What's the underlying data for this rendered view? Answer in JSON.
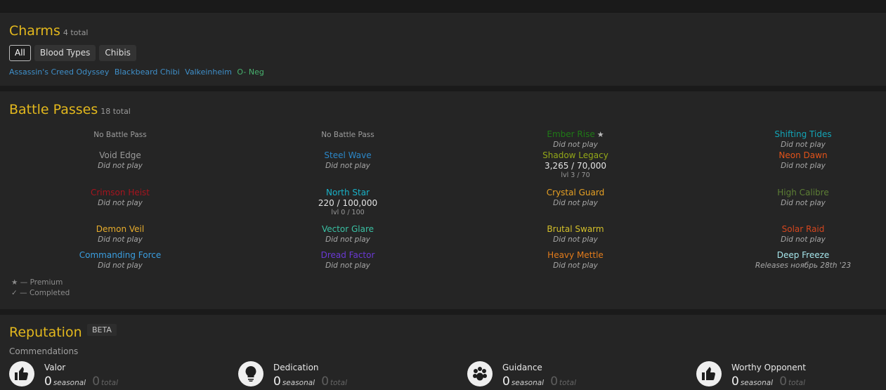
{
  "charms": {
    "title": "Charms",
    "count": "4 total",
    "filters": [
      {
        "label": "All",
        "active": true
      },
      {
        "label": "Blood Types",
        "active": false
      },
      {
        "label": "Chibis",
        "active": false
      }
    ],
    "items": [
      {
        "name": "Assassin's Creed Odyssey",
        "color": "#3f8fc9"
      },
      {
        "name": "Blackbeard Chibi",
        "color": "#3f8fc9"
      },
      {
        "name": "Valkeinheim",
        "color": "#3f8fc9"
      },
      {
        "name": "O- Neg",
        "color": "#47b16e"
      }
    ]
  },
  "battle_passes": {
    "title": "Battle Passes",
    "count": "18 total",
    "columns": [
      [
        {
          "type": "plain",
          "text": "No Battle Pass"
        },
        {
          "name": "Void Edge",
          "status": "Did not play",
          "color": "#9a9a9a"
        },
        {
          "name": "Crimson Heist",
          "status": "Did not play",
          "color": "#a7141e"
        },
        {
          "name": "Demon Veil",
          "status": "Did not play",
          "color": "#e8ad2c"
        },
        {
          "name": "Commanding Force",
          "status": "Did not play",
          "color": "#3a9ee0"
        }
      ],
      [
        {
          "type": "plain",
          "text": "No Battle Pass"
        },
        {
          "name": "Steel Wave",
          "status": "Did not play",
          "color": "#2b87c8"
        },
        {
          "name": "North Star",
          "progress": "220 / 100,000",
          "level": "lvl 0 / 100",
          "color": "#18b1c7"
        },
        {
          "name": "Vector Glare",
          "status": "Did not play",
          "color": "#3ac1a4"
        },
        {
          "name": "Dread Factor",
          "status": "Did not play",
          "color": "#6a39d4"
        }
      ],
      [
        {
          "name": "Ember Rise",
          "status": "Did not play",
          "color": "#1f7a16",
          "premium": true
        },
        {
          "name": "Shadow Legacy",
          "progress": "3,265 / 70,000",
          "level": "lvl 3 / 70",
          "color": "#93a718"
        },
        {
          "name": "Crystal Guard",
          "status": "Did not play",
          "color": "#e6a024"
        },
        {
          "name": "Brutal Swarm",
          "status": "Did not play",
          "color": "#d4c02a"
        },
        {
          "name": "Heavy Mettle",
          "status": "Did not play",
          "color": "#e37c1b"
        }
      ],
      [
        {
          "name": "Shifting Tides",
          "status": "Did not play",
          "color": "#13a4b6"
        },
        {
          "name": "Neon Dawn",
          "status": "Did not play",
          "color": "#e2531a"
        },
        {
          "name": "High Calibre",
          "status": "Did not play",
          "color": "#5d7f35"
        },
        {
          "name": "Solar Raid",
          "status": "Did not play",
          "color": "#d4461e"
        },
        {
          "name": "Deep Freeze",
          "status": "Releases ноябрь 28th '23",
          "color": "#a6e6ec"
        }
      ]
    ],
    "legend_premium": "★ — Premium",
    "legend_completed": "✓ — Completed",
    "star_glyph": "★"
  },
  "reputation": {
    "title": "Reputation",
    "badge": "BETA",
    "subhead": "Commendations",
    "items": [
      {
        "label": "Valor",
        "seasonal": "0",
        "seasonal_label": "seasonal",
        "total": "0",
        "total_label": "total",
        "icon": "thumbs-up-icon"
      },
      {
        "label": "Dedication",
        "seasonal": "0",
        "seasonal_label": "seasonal",
        "total": "0",
        "total_label": "total",
        "icon": "lightbulb-icon"
      },
      {
        "label": "Guidance",
        "seasonal": "0",
        "seasonal_label": "seasonal",
        "total": "0",
        "total_label": "total",
        "icon": "paw-icon"
      },
      {
        "label": "Worthy Opponent",
        "seasonal": "0",
        "seasonal_label": "seasonal",
        "total": "0",
        "total_label": "total",
        "icon": "thumbs-up-icon"
      }
    ]
  },
  "colors": {
    "accent": "#e3b81d",
    "panel": "#252525",
    "background": "#1a1a1a"
  }
}
